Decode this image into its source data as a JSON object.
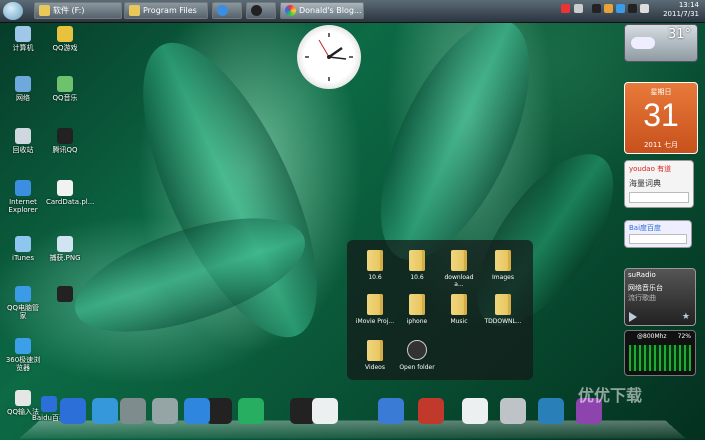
{
  "taskbar": {
    "tasks": [
      {
        "label": "软件 (F:)",
        "icon": "folder-icon"
      },
      {
        "label": "Program Files",
        "icon": "folder-icon"
      },
      {
        "label": "",
        "icon": "internet-explorer-icon"
      },
      {
        "label": "",
        "icon": "qq-penguin-icon"
      },
      {
        "label": "Donald's Blog...",
        "icon": "browser-icon"
      }
    ],
    "time": "13:14",
    "date": "2011/7/31"
  },
  "desktop_icons": [
    {
      "label": "计算机",
      "icon": "computer-icon",
      "color": "#9fc7e8"
    },
    {
      "label": "QQ游戏",
      "icon": "qq-game-icon",
      "color": "#e8c23c"
    },
    {
      "label": "网络",
      "icon": "network-icon",
      "color": "#6fa8dc"
    },
    {
      "label": "QQ音乐",
      "icon": "qq-music-icon",
      "color": "#6cc36c"
    },
    {
      "label": "回收站",
      "icon": "recycle-bin-icon",
      "color": "#cfd8df"
    },
    {
      "label": "腾讯QQ",
      "icon": "qq-penguin-icon",
      "color": "#222222"
    },
    {
      "label": "Internet Explorer",
      "icon": "internet-explorer-icon",
      "color": "#3c8ee0"
    },
    {
      "label": "CardData.pl...",
      "icon": "file-icon",
      "color": "#f2f2f2"
    },
    {
      "label": "iTunes",
      "icon": "itunes-icon",
      "color": "#8fc6f0"
    },
    {
      "label": "捕获.PNG",
      "icon": "image-file-icon",
      "color": "#d0e4f2"
    },
    {
      "label": "QQ电脑管家",
      "icon": "qq-manager-icon",
      "color": "#3a9be6"
    },
    {
      "label": "",
      "icon": "qq-penguin-icon",
      "color": "#222222"
    },
    {
      "label": "360极速浏览器",
      "icon": "360-browser-icon",
      "color": "#3ca0e8"
    },
    {
      "label": "QQ输入法",
      "icon": "qq-input-icon",
      "color": "#e6e6e6"
    },
    {
      "label": "Baidu百科",
      "icon": "baidu-icon",
      "color": "#2d6fd8"
    }
  ],
  "folders": [
    {
      "label": "10.6"
    },
    {
      "label": "10.6"
    },
    {
      "label": "download a..."
    },
    {
      "label": "Images"
    },
    {
      "label": "iMovie Proj..."
    },
    {
      "label": "iphone"
    },
    {
      "label": "Music"
    },
    {
      "label": "TDDOWNL..."
    },
    {
      "label": "Videos"
    }
  ],
  "open_folder_label": "Open folder",
  "gadgets": {
    "weather": {
      "temp": "31°"
    },
    "calendar": {
      "weekday": "星期日",
      "day": "31",
      "month": "2011 七月"
    },
    "dict": {
      "brand": "youdao 有道",
      "title": "海量词典"
    },
    "baidu": {
      "brand": "Bai度百度"
    },
    "radio": {
      "title": "suRadio",
      "station": "网络音乐台",
      "sub": "流行歌曲"
    },
    "cpu": {
      "label": "@800Mhz",
      "percent": "72%"
    }
  },
  "watermark": "优优下载",
  "dock_icons": [
    "finder-icon",
    "itunes-icon",
    "preview-icon",
    "mail-icon",
    "photoshop-icon",
    "misc-icon",
    "qq-penguin-icon",
    "firefox-icon",
    "qq-penguin-icon",
    "notes-icon",
    "calculator-icon",
    "ruler-icon",
    "twitter-icon",
    "ie-icon",
    "baidu-icon"
  ]
}
